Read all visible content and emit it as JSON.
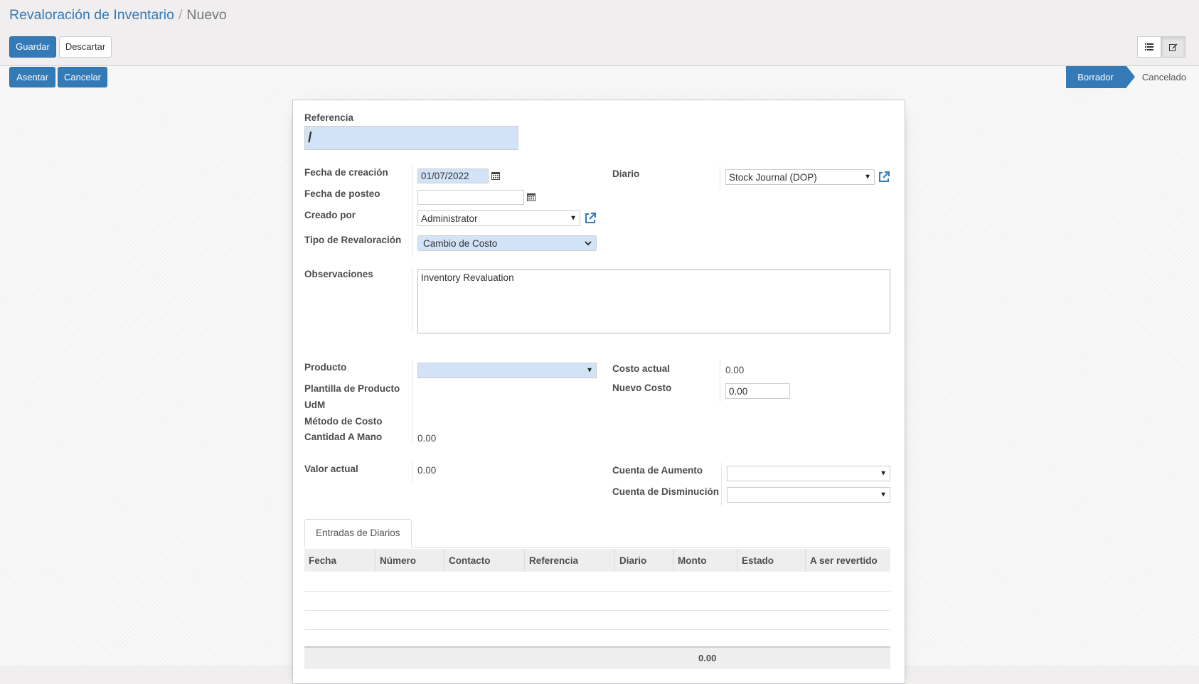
{
  "breadcrumb": {
    "parent": "Revaloración de Inventario",
    "separator": "/",
    "current": "Nuevo"
  },
  "buttons": {
    "save": "Guardar",
    "discard": "Descartar",
    "post": "Asentar",
    "cancel": "Cancelar"
  },
  "statusbar": {
    "stages": [
      "Borrador",
      "Cancelado"
    ],
    "active": "Borrador"
  },
  "views": {
    "list": "list-icon",
    "form": "edit-icon"
  },
  "form": {
    "reference": {
      "label": "Referencia",
      "value": "/"
    },
    "creation_date": {
      "label": "Fecha de creación",
      "value": "01/07/2022"
    },
    "post_date": {
      "label": "Fecha de posteo",
      "value": ""
    },
    "created_by": {
      "label": "Creado por",
      "value": "Administrator"
    },
    "revaluation_type": {
      "label": "Tipo de Revaloración",
      "value": "Cambio de Costo"
    },
    "journal": {
      "label": "Diario",
      "value": "Stock Journal (DOP)"
    },
    "observations": {
      "label": "Observaciones",
      "value": "Inventory Revaluation"
    },
    "product": {
      "label": "Producto",
      "value": ""
    },
    "product_template": {
      "label": "Plantilla de Producto"
    },
    "uom": {
      "label": "UdM"
    },
    "cost_method": {
      "label": "Método de Costo"
    },
    "qty_on_hand": {
      "label": "Cantidad A Mano",
      "value": "0.00"
    },
    "current_cost": {
      "label": "Costo actual",
      "value": "0.00"
    },
    "new_cost": {
      "label": "Nuevo Costo",
      "value": "0.00"
    },
    "current_value": {
      "label": "Valor actual",
      "value": "0.00"
    },
    "increase_account": {
      "label": "Cuenta de Aumento",
      "value": ""
    },
    "decrease_account": {
      "label": "Cuenta de Disminución",
      "value": ""
    }
  },
  "tabs": [
    "Entradas de Diarios"
  ],
  "journal_entries": {
    "columns": [
      "Fecha",
      "Número",
      "Contacto",
      "Referencia",
      "Diario",
      "Monto",
      "Estado",
      "A ser revertido"
    ],
    "rows": [],
    "total": "0.00"
  },
  "colors": {
    "primary": "#337ab7",
    "required_field": "#d2e3f7"
  }
}
